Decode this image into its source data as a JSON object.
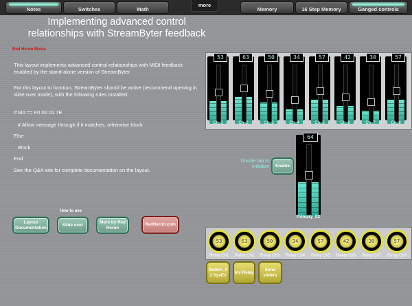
{
  "tabs": [
    {
      "label": "Notes",
      "active": true
    },
    {
      "label": "Switches",
      "active": false
    },
    {
      "label": "Math",
      "active": false
    },
    {
      "label": "Memory",
      "active": false
    },
    {
      "label": "16 Step Memory",
      "active": false
    },
    {
      "label": "Ganged controls",
      "active": true
    }
  ],
  "more_label": "more",
  "title": "Implementing advanced control relationships with StreamByter feedback",
  "brand": "Red Heron Music",
  "paragraphs": [
    "This layout implements advanced control relationships with MIDI feedback enabled by the stand-alone version of StreamByter.",
    "For this layout to function, StreamByter should be active (recommend opening in slide-over mode), with the following rules installed:",
    "If M0 == F0 00 01 7E",
    "# Allow message through if it matches, otherwise block",
    "Else",
    "Block",
    "End",
    "See the Q&A site for complete documentation on the layout."
  ],
  "left_buttons": {
    "layout_doc": "Layout Documentation",
    "howto": "How to use",
    "slide_over": "Slide over",
    "more_red_heron": "More by Red Heron",
    "redheron": "RedHeron.com"
  },
  "faders": [
    {
      "label": "Ch_1",
      "value": "53",
      "level": 0.42
    },
    {
      "label": "Ch_2",
      "value": "63",
      "level": 0.5
    },
    {
      "label": "Ch_3",
      "value": "50",
      "level": 0.4
    },
    {
      "label": "Ch_4",
      "value": "34",
      "level": 0.27
    },
    {
      "label": "Ch_5",
      "value": "57",
      "level": 0.45
    },
    {
      "label": "Ch_6",
      "value": "42",
      "level": 0.33
    },
    {
      "label": "Ch_7",
      "value": "30",
      "level": 0.24
    },
    {
      "label": "Ch_8",
      "value": "57",
      "level": 0.45
    }
  ],
  "primary": {
    "label": "Primary_02",
    "value": "64",
    "level": 0.5
  },
  "double_tap": "Double tap to initialize",
  "enable_label": "Enable",
  "knobs": [
    {
      "label": "Relay Ch1",
      "value": "53"
    },
    {
      "label": "Relay Ch2",
      "value": "63"
    },
    {
      "label": "Relay Ch3",
      "value": "50"
    },
    {
      "label": "Relay Ch4",
      "value": "34"
    },
    {
      "label": "Relay Ch5",
      "value": "57"
    },
    {
      "label": "Relay Ch6",
      "value": "42"
    },
    {
      "label": "Relay Ch7",
      "value": "30"
    },
    {
      "label": "Relay Ch8",
      "value": "57"
    }
  ],
  "bottom_buttons": {
    "switch": "Switch_0 2 SysEx",
    "inv_relay": "Inv Relay",
    "send_sliders": "Send sliders"
  },
  "colors": {
    "accent": "#8ff0d4",
    "fader_fill": "#4fd6bb",
    "brand_red": "#d51010",
    "knob_yellow": "#e4df3b"
  }
}
